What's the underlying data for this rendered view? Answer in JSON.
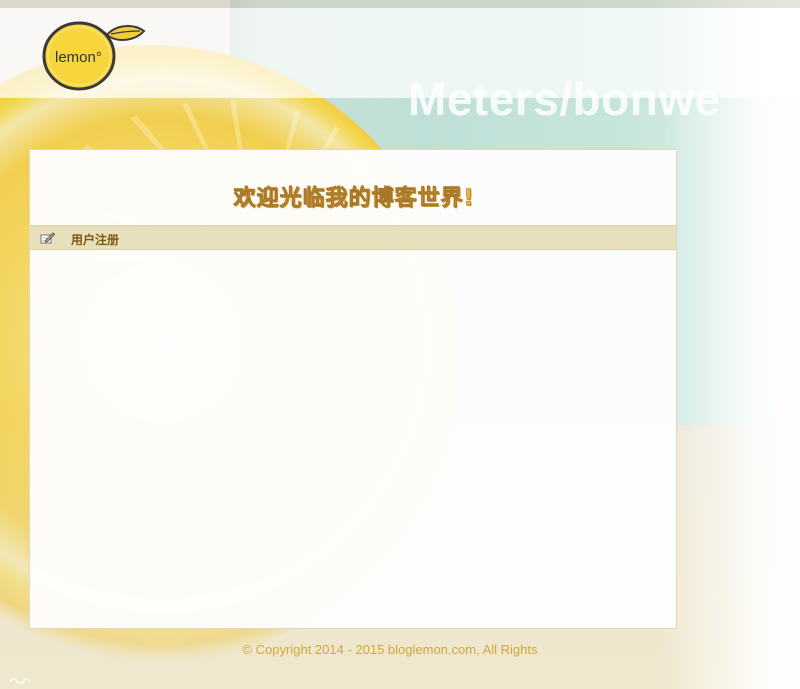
{
  "header": {
    "logo_text": "lemon°"
  },
  "background": {
    "mug_text": "Meters/bonwe"
  },
  "main": {
    "welcome_title": "欢迎光临我的博客世界!",
    "section": {
      "icon": "pencil-icon",
      "title": "用户注册"
    }
  },
  "footer": {
    "copyright": "© Copyright 2014 - 2015 bloglemon.com, All Rights"
  },
  "colors": {
    "accent_gold": "#e9b53a",
    "section_bar": "#e8dfbd",
    "section_text": "#7a5a10",
    "footer_text": "#d2a83c"
  }
}
